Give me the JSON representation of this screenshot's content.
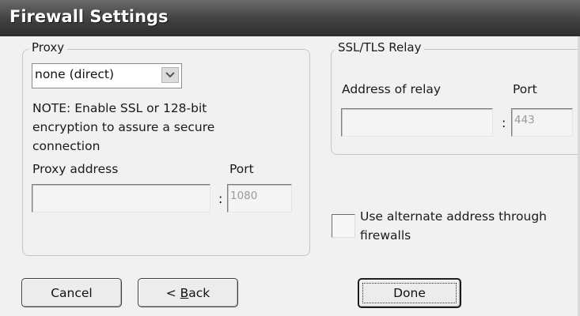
{
  "window": {
    "title": "Firewall Settings"
  },
  "proxy": {
    "legend": "Proxy",
    "type_selected": "none (direct)",
    "note": [
      "NOTE: Enable SSL or 128-bit",
      "encryption to assure a secure",
      "connection"
    ],
    "address_label": "Proxy address",
    "address_value": "",
    "port_label": "Port",
    "port_value": "1080",
    "separator": ":"
  },
  "relay": {
    "legend": "SSL/TLS Relay",
    "address_label": "Address of relay",
    "address_value": "",
    "port_label": "Port",
    "port_value": "443",
    "separator": ":"
  },
  "alternate": {
    "checked": false,
    "label_line1": "Use alternate address through",
    "label_line2": "firewalls"
  },
  "buttons": {
    "cancel": "Cancel",
    "back_prefix": "< ",
    "back_mnemonic": "B",
    "back_rest": "ack",
    "done": "Done"
  },
  "icons": {
    "dropdown": "chevron-down-icon"
  }
}
